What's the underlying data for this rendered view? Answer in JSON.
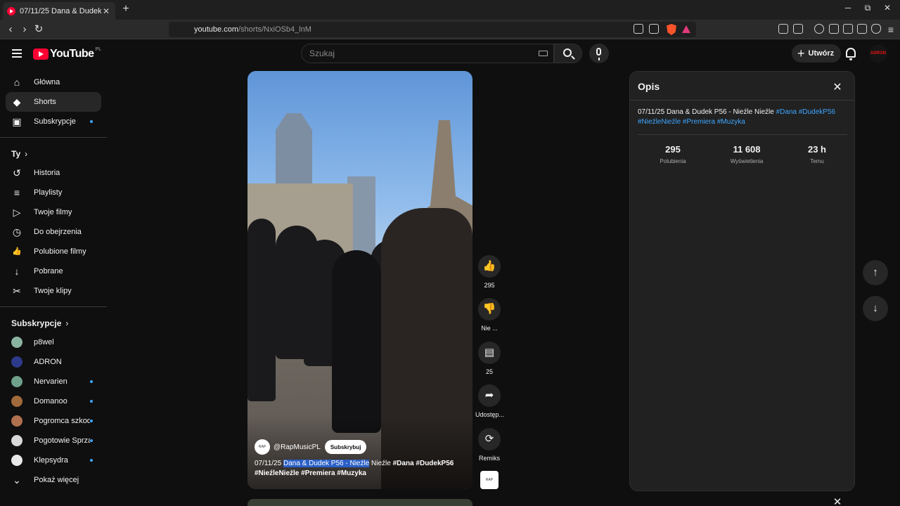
{
  "browser": {
    "tab_title": "07/11/25 Dana & Dudek P56 - N",
    "tab_close": "✕",
    "new_tab": "+",
    "url_host": "youtube.com",
    "url_path": "/shorts/NxiOSb4_lnM",
    "minimize": "─",
    "maximize": "⧉",
    "close": "✕"
  },
  "header": {
    "logo_text": "YouTube",
    "logo_country": "PL",
    "search_placeholder": "Szukaj",
    "create_plus": "+",
    "create_label": "Utwórz",
    "avatar_text": "ADRON"
  },
  "sidebar": {
    "primary": [
      {
        "label": "Główna",
        "icon": "⌂",
        "active": false
      },
      {
        "label": "Shorts",
        "icon": "◆",
        "active": true
      },
      {
        "label": "Subskrypcje",
        "icon": "▣",
        "active": false
      }
    ],
    "you_heading": "Ty",
    "you_items": [
      {
        "label": "Historia",
        "icon": "↺"
      },
      {
        "label": "Playlisty",
        "icon": "≡"
      },
      {
        "label": "Twoje filmy",
        "icon": "▷"
      },
      {
        "label": "Do obejrzenia",
        "icon": "◷"
      },
      {
        "label": "Polubione filmy",
        "icon": "👍"
      },
      {
        "label": "Pobrane",
        "icon": "↓"
      },
      {
        "label": "Twoje klipy",
        "icon": "✂"
      }
    ],
    "subs_heading": "Subskrypcje",
    "subscriptions": [
      {
        "label": "p8wel",
        "color": "#8ab4a0",
        "dot": false
      },
      {
        "label": "ADRON",
        "color": "#2d3a8c",
        "dot": false
      },
      {
        "label": "Nervarien",
        "color": "#6fa08a",
        "dot": true
      },
      {
        "label": "Domanoo",
        "color": "#a06a3a",
        "dot": true
      },
      {
        "label": "Pogromca szkod...",
        "color": "#b07050",
        "dot": true
      },
      {
        "label": "Pogotowie Sprzą...",
        "color": "#d8d8d8",
        "dot": true
      },
      {
        "label": "Klepsydra",
        "color": "#e8e8e8",
        "dot": true
      }
    ],
    "show_more": "Pokaż więcej",
    "show_more_icon": "⌄"
  },
  "video": {
    "channel_avatar_text": "RAP",
    "channel": "@RapMusicPL",
    "subscribe": "Subskrybuj",
    "caption_date": "07/11/25 ",
    "caption_highlight": "Dana & Dudek P56 - Nieźle",
    "caption_rest": " Nieźle ",
    "caption_tags_1": "#Dana #DudekP56",
    "caption_tags_2": "#NieźleNieźle #Premiera #Muzyka"
  },
  "actions": {
    "like_icon": "👍",
    "like_count": "295",
    "dislike_icon": "👎",
    "dislike_label": "Nie ...",
    "comment_icon": "▤",
    "comment_count": "25",
    "share_icon": "➦",
    "share_label": "Udostęp...",
    "remix_icon": "⟳",
    "remix_label": "Remiks",
    "sound_thumb_text": "RAP"
  },
  "panel": {
    "title": "Opis",
    "close": "✕",
    "desc_text": "07/11/25 Dana & Dudek P56 - Nieźle Nieźle ",
    "desc_tags_1": "#Dana #DudekP56",
    "desc_tags_2": "#NieźleNieźle #Premiera #Muzyka",
    "stats": [
      {
        "value": "295",
        "label": "Polubienia"
      },
      {
        "value": "11 608",
        "label": "Wyświetlenia"
      },
      {
        "value": "23 h",
        "label": "Temu"
      }
    ]
  },
  "nav": {
    "up": "↑",
    "down": "↓",
    "bottom_close": "✕"
  }
}
